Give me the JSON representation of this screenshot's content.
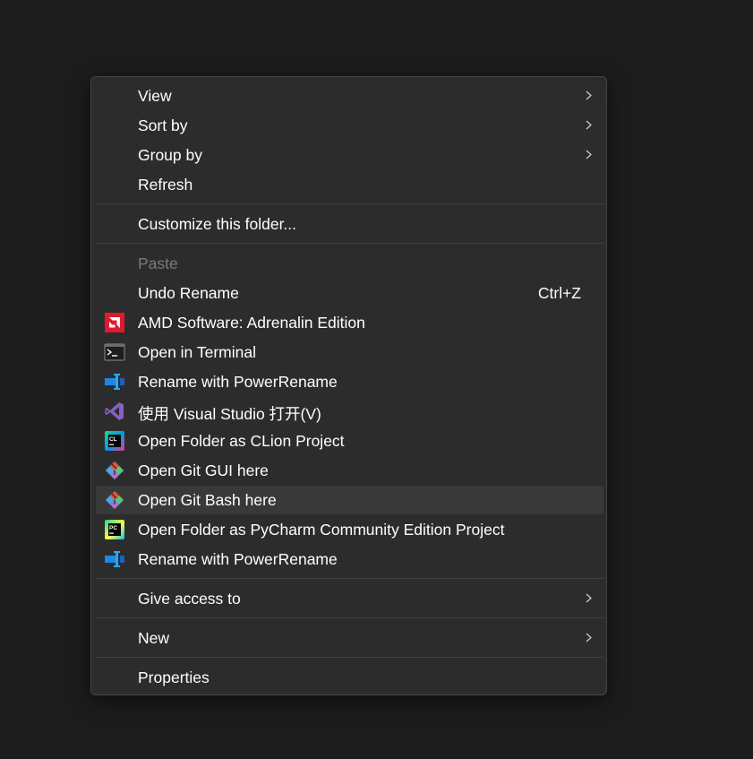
{
  "menu": {
    "view": "View",
    "sort_by": "Sort by",
    "group_by": "Group by",
    "refresh": "Refresh",
    "customize": "Customize this folder...",
    "paste": "Paste",
    "undo_rename": "Undo Rename",
    "undo_shortcut": "Ctrl+Z",
    "amd": "AMD Software: Adrenalin Edition",
    "terminal": "Open in Terminal",
    "power_rename_1": "Rename with PowerRename",
    "visual_studio": "使用 Visual Studio 打开(V)",
    "clion": "Open Folder as CLion Project",
    "git_gui": "Open Git GUI here",
    "git_bash": "Open Git Bash here",
    "pycharm": "Open Folder as PyCharm Community Edition Project",
    "power_rename_2": "Rename with PowerRename",
    "give_access": "Give access to",
    "new": "New",
    "properties": "Properties"
  },
  "icons": {
    "amd": "amd-icon",
    "terminal": "terminal-icon",
    "power_rename": "powerrename-icon",
    "visual_studio": "visual-studio-icon",
    "clion": "clion-icon",
    "git": "git-icon",
    "pycharm": "pycharm-icon",
    "submenu": "chevron-right-icon"
  },
  "icon_text": {
    "clion": "CL",
    "pycharm": "PC"
  },
  "colors": {
    "background": "#1c1c1c",
    "menu": "#2c2c2c",
    "hover": "#393939",
    "amd_red": "#e2192e",
    "vs_purple": "#8661c5",
    "powerrename_blue": "#1e88e5"
  }
}
